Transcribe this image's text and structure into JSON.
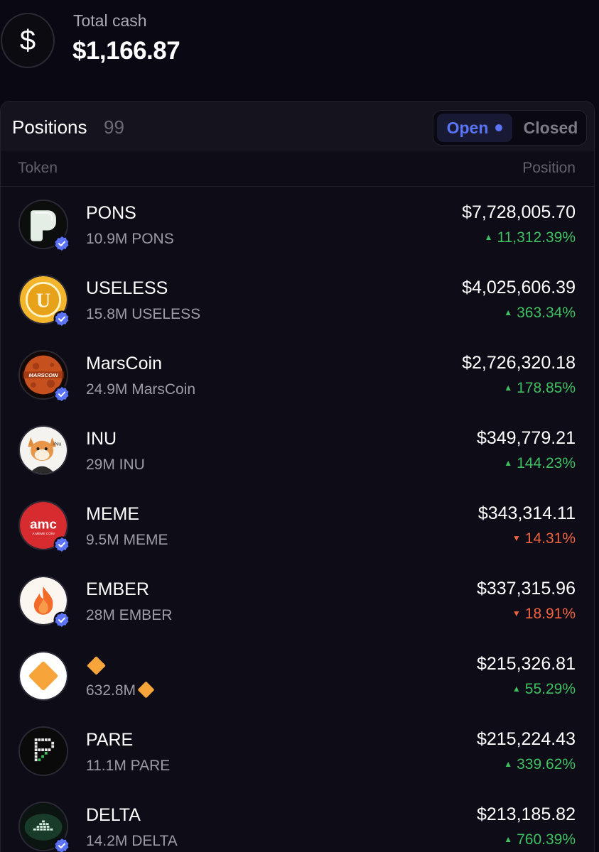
{
  "header": {
    "cash_label": "Total cash",
    "cash_value": "$1,166.87",
    "cash_icon": "dollar-icon"
  },
  "positions": {
    "title": "Positions",
    "count": "99",
    "toggle": {
      "open_label": "Open",
      "closed_label": "Closed",
      "selected": "Open"
    },
    "col_token": "Token",
    "col_position": "Position",
    "rows": [
      {
        "name": "PONS",
        "amount": "10.9M PONS",
        "value": "$7,728,005.70",
        "change": "11,312.39%",
        "direction": "up",
        "verified": true,
        "icon": "pons-logo"
      },
      {
        "name": "USELESS",
        "amount": "15.8M USELESS",
        "value": "$4,025,606.39",
        "change": "363.34%",
        "direction": "up",
        "verified": true,
        "icon": "useless-logo"
      },
      {
        "name": "MarsCoin",
        "amount": "24.9M MarsCoin",
        "value": "$2,726,320.18",
        "change": "178.85%",
        "direction": "up",
        "verified": true,
        "icon": "marscoin-logo"
      },
      {
        "name": "INU",
        "amount": "29M INU",
        "value": "$349,779.21",
        "change": "144.23%",
        "direction": "up",
        "verified": false,
        "icon": "inu-logo"
      },
      {
        "name": "MEME",
        "amount": "9.5M MEME",
        "value": "$343,314.11",
        "change": "14.31%",
        "direction": "down",
        "verified": true,
        "icon": "meme-logo"
      },
      {
        "name": "EMBER",
        "amount": "28M EMBER",
        "value": "$337,315.96",
        "change": "18.91%",
        "direction": "down",
        "verified": true,
        "icon": "ember-logo"
      },
      {
        "name": "",
        "amount": "632.8M",
        "value": "$215,326.81",
        "change": "55.29%",
        "direction": "up",
        "verified": false,
        "icon": "diamond-logo"
      },
      {
        "name": "PARE",
        "amount": "11.1M PARE",
        "value": "$215,224.43",
        "change": "339.62%",
        "direction": "up",
        "verified": false,
        "icon": "pare-logo"
      },
      {
        "name": "DELTA",
        "amount": "14.2M DELTA",
        "value": "$213,185.82",
        "change": "760.39%",
        "direction": "up",
        "verified": true,
        "icon": "delta-logo"
      }
    ]
  },
  "colors": {
    "background": "#0a0913",
    "accent": "#5b74f5",
    "positive": "#3fc061",
    "negative": "#f0623f",
    "muted": "#9c9ba6"
  },
  "icons": {
    "up_arrow": "▲",
    "down_arrow": "▼",
    "amc_text": "amc",
    "amc_sub": "A MEME COIN",
    "mars_text": "MARSCOIN",
    "useless_letter": "U",
    "inu_text": "iNu"
  }
}
